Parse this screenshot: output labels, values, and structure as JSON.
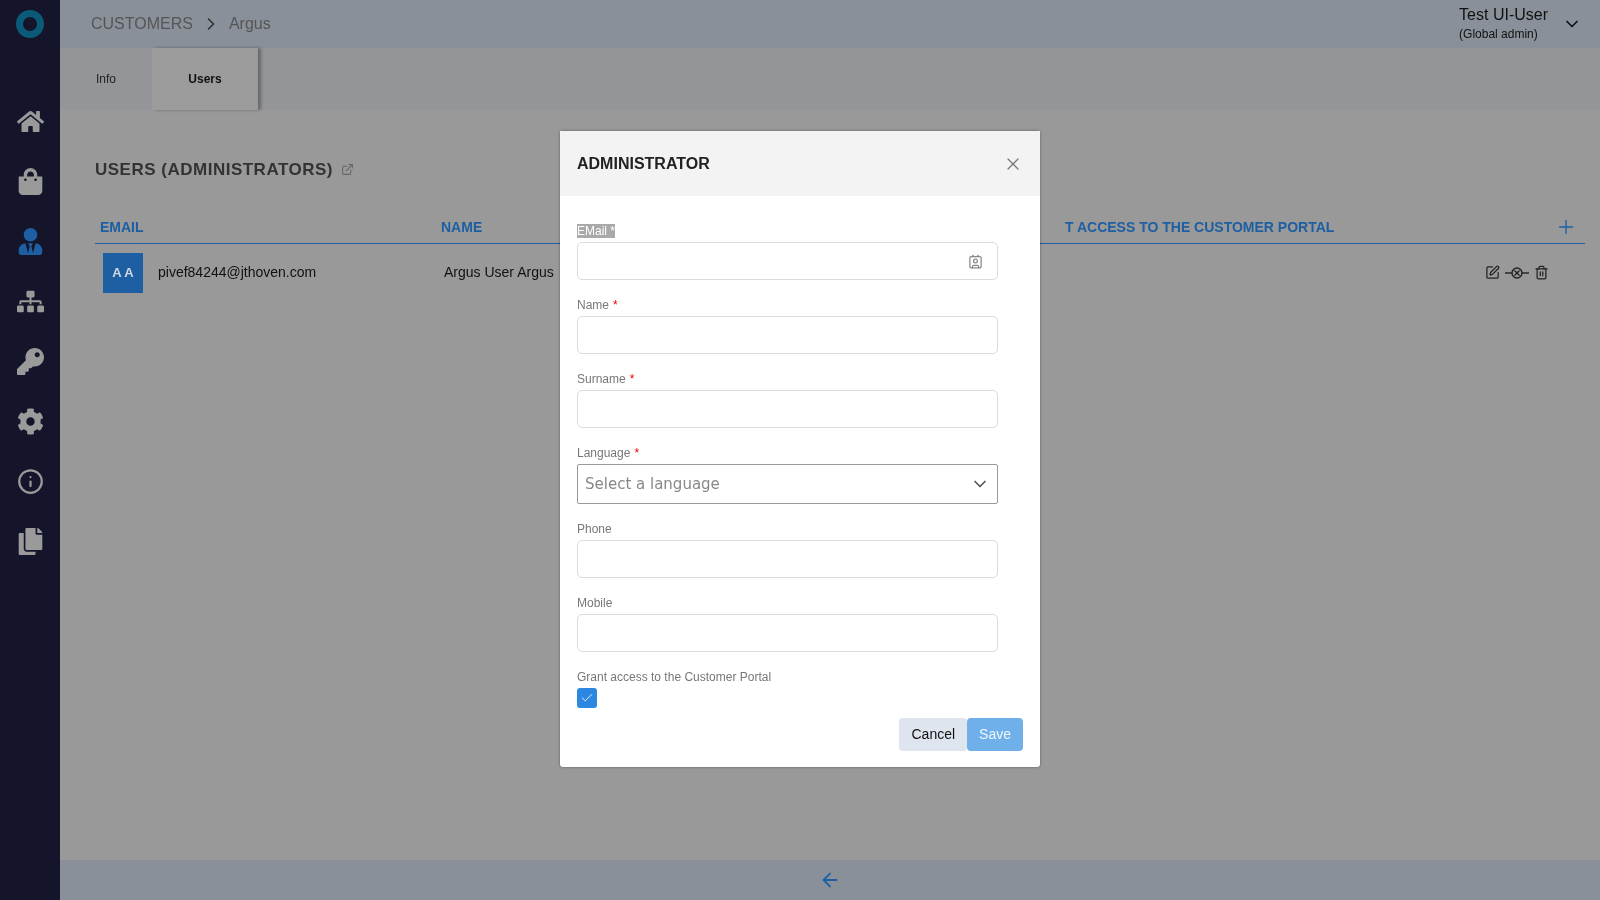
{
  "sidebar": {
    "items": [
      {
        "kind": "home",
        "selected": false
      },
      {
        "kind": "bag",
        "selected": false
      },
      {
        "kind": "user",
        "selected": true
      },
      {
        "kind": "org",
        "selected": false
      },
      {
        "kind": "key",
        "selected": false
      },
      {
        "kind": "gear",
        "selected": false
      },
      {
        "kind": "info",
        "selected": false
      },
      {
        "kind": "help",
        "selected": false
      }
    ]
  },
  "breadcrumb": [
    "CUSTOMERS",
    "Argus"
  ],
  "user": {
    "name": "Test UI-User",
    "role": "(Global admin)"
  },
  "tabs": [
    {
      "label": "Info",
      "selected": false
    },
    {
      "label": "Users",
      "selected": true
    }
  ],
  "section_title": "USERS (ADMINISTRATORS)",
  "table": {
    "columns": [
      "EMAIL",
      "NAME",
      "T ACCESS TO THE CUSTOMER PORTAL"
    ],
    "rows": [
      {
        "initials": "A A",
        "email": "pivef84244@jthoven.com",
        "name": "Argus User Argus"
      }
    ]
  },
  "dialog": {
    "title": "ADMINISTRATOR",
    "fields": [
      {
        "kind": "email",
        "label": "EMail *",
        "label_highlighted": true
      },
      {
        "kind": "text",
        "label": "Name",
        "required_mark": "*",
        "label_highlighted": false
      },
      {
        "kind": "text",
        "label": "Surname",
        "required_mark": "*",
        "label_highlighted": false
      },
      {
        "kind": "select",
        "label": "Language",
        "required_mark": "*",
        "label_highlighted": false,
        "placeholder": "Select a language"
      },
      {
        "kind": "text",
        "label": "Phone",
        "label_highlighted": false
      },
      {
        "kind": "text",
        "label": "Mobile",
        "label_highlighted": false
      },
      {
        "kind": "checkbox",
        "label": "Grant access to the Customer Portal",
        "label_highlighted": false,
        "checked": true
      }
    ],
    "buttons": [
      {
        "label": "Cancel",
        "kind": "secondary",
        "disabled": false
      },
      {
        "label": "Save",
        "kind": "primary",
        "disabled": true
      }
    ]
  }
}
